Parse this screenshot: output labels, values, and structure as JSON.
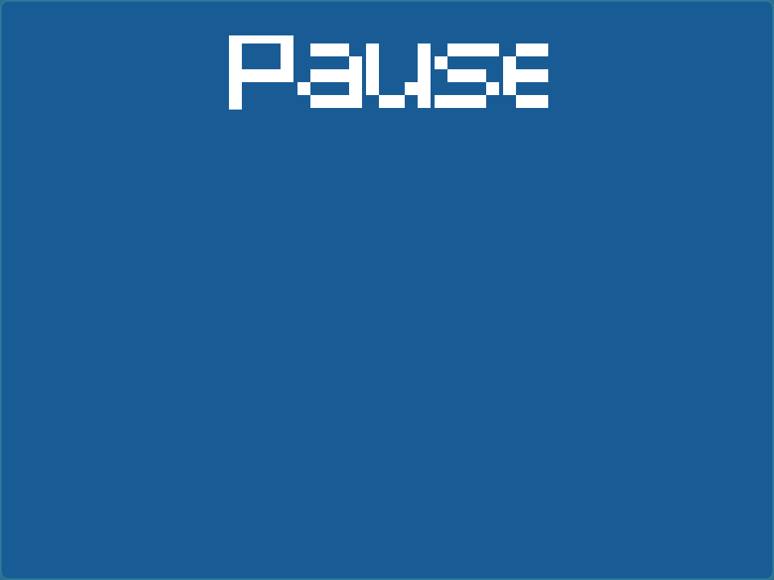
{
  "game": {
    "title": "Pause",
    "colors": {
      "background": "#195c95",
      "text": "#ffffff",
      "border": "#2e7a96"
    }
  }
}
